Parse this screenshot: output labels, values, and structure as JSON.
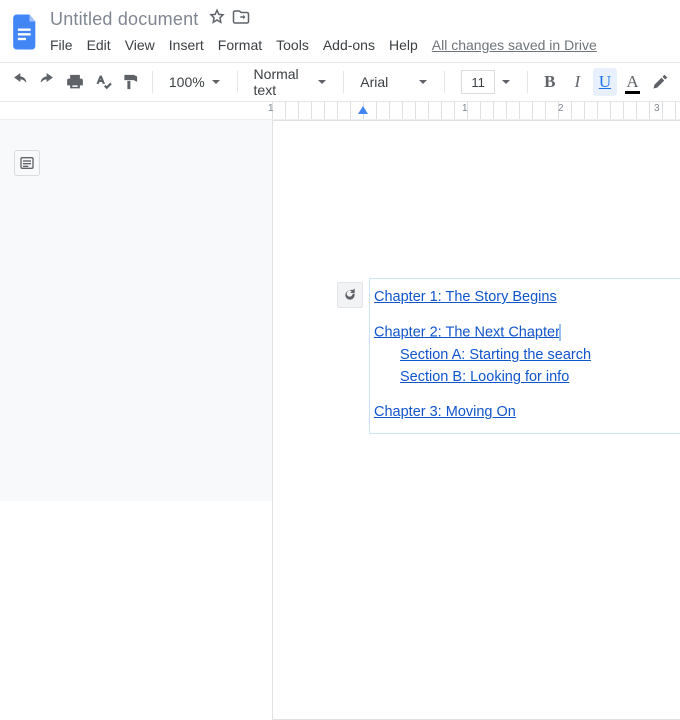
{
  "title": "Untitled document",
  "save_status": "All changes saved in Drive",
  "menu": [
    "File",
    "Edit",
    "View",
    "Insert",
    "Format",
    "Tools",
    "Add-ons",
    "Help"
  ],
  "toolbar": {
    "zoom": "100%",
    "style": "Normal text",
    "font": "Arial",
    "font_size": "11"
  },
  "ruler": {
    "marks": [
      "1",
      "1",
      "2",
      "3"
    ]
  },
  "toc": {
    "items": [
      {
        "level": 1,
        "label": "Chapter 1: The Story Begins"
      },
      {
        "level": 1,
        "label": "Chapter 2: The Next Chapter",
        "cursor": true
      },
      {
        "level": 2,
        "label": "Section A: Starting the search"
      },
      {
        "level": 2,
        "label": "Section B: Looking for info"
      },
      {
        "level": 1,
        "label": "Chapter 3: Moving On"
      }
    ]
  }
}
